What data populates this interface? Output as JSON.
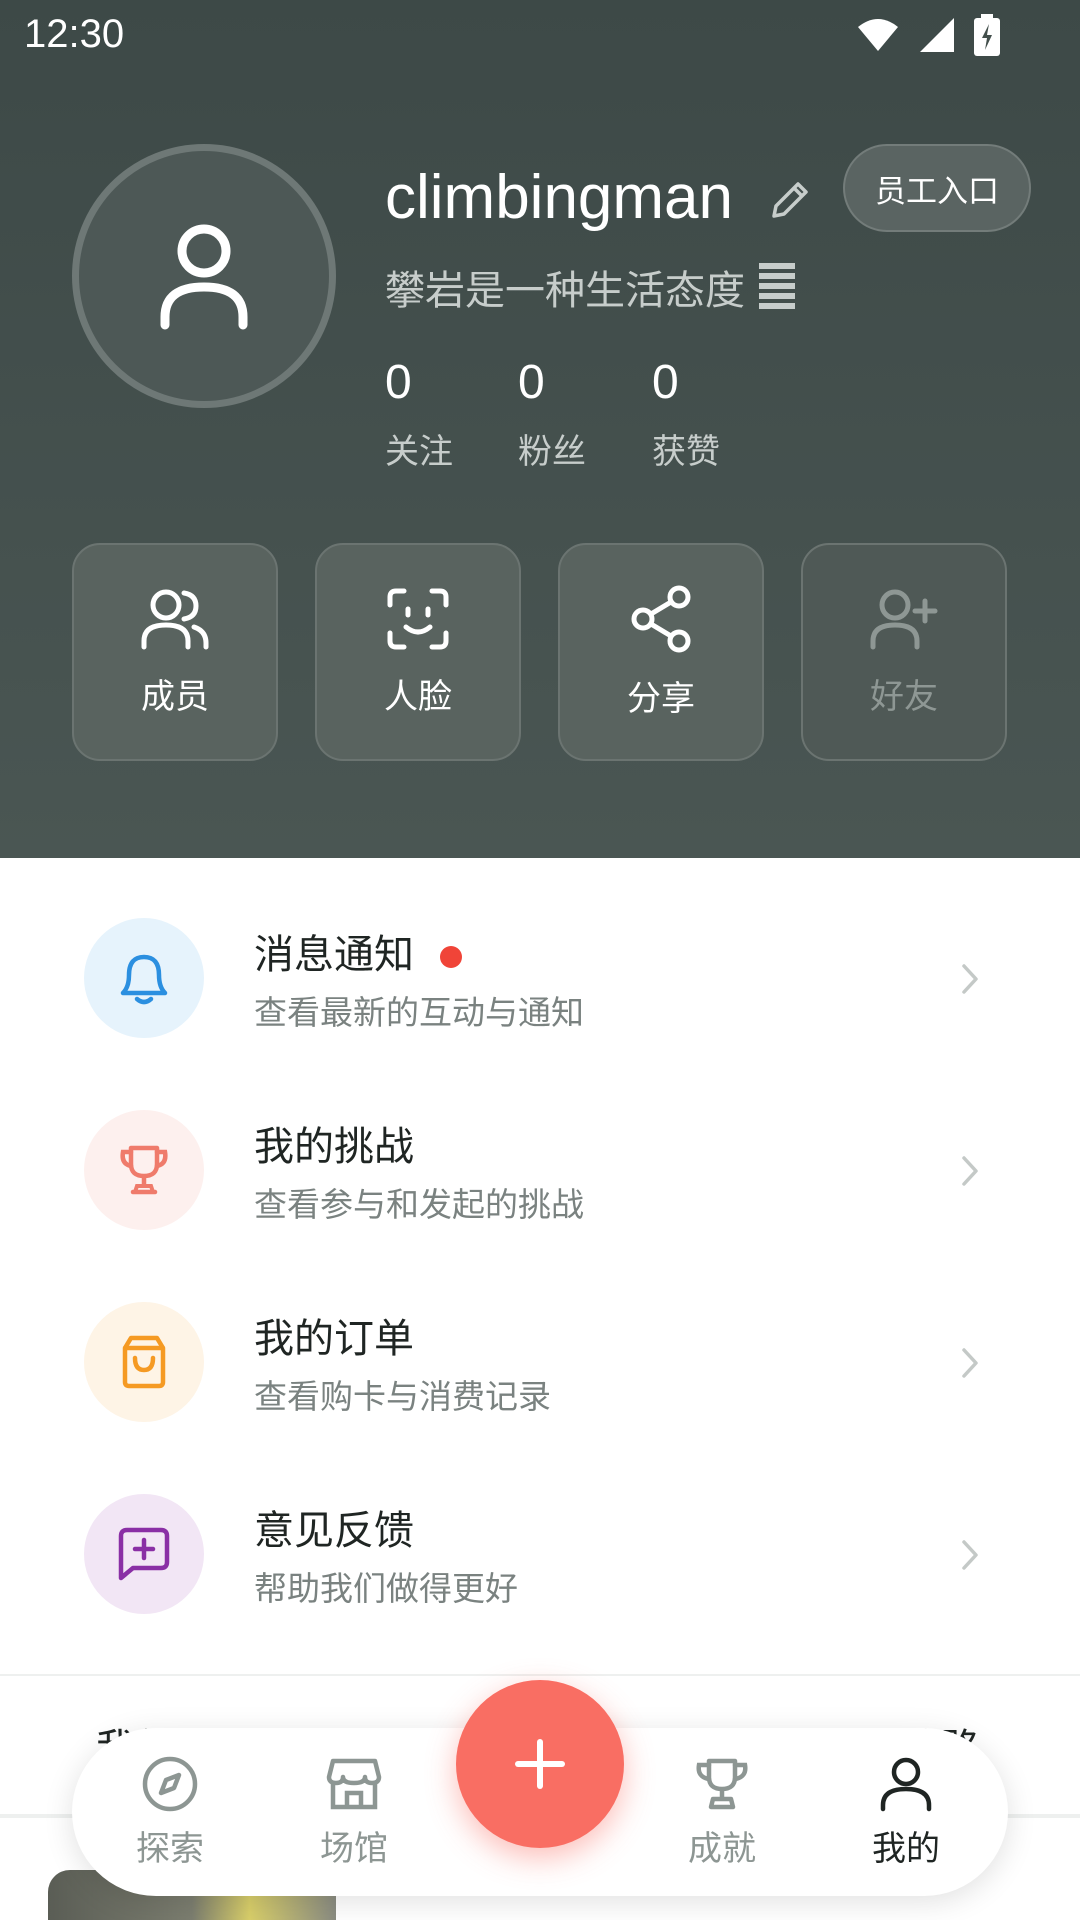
{
  "status_bar": {
    "time": "12:30",
    "icons": [
      "wifi-icon",
      "signal-icon",
      "battery-charging-icon"
    ]
  },
  "profile": {
    "username": "climbingman",
    "bio": "攀岩是一种生活态度",
    "staff_entry": "员工入口",
    "stats": [
      {
        "value": "0",
        "label": "关注"
      },
      {
        "value": "0",
        "label": "粉丝"
      },
      {
        "value": "0",
        "label": "获赞"
      }
    ]
  },
  "actions": [
    {
      "label": "成员",
      "icon": "users-icon"
    },
    {
      "label": "人脸",
      "icon": "face-scan-icon"
    },
    {
      "label": "分享",
      "icon": "share-icon"
    },
    {
      "label": "好友",
      "icon": "add-friend-icon"
    }
  ],
  "menu": [
    {
      "title": "消息通知",
      "subtitle": "查看最新的互动与通知",
      "icon": "bell-icon",
      "color": "#2b8fe0",
      "bg": "#e6f3fc",
      "badge": true
    },
    {
      "title": "我的挑战",
      "subtitle": "查看参与和发起的挑战",
      "icon": "trophy-icon",
      "color": "#ef7b6b",
      "bg": "#fdf0ee",
      "badge": false
    },
    {
      "title": "我的订单",
      "subtitle": "查看购卡与消费记录",
      "icon": "shopping-bag-icon",
      "color": "#f59a23",
      "bg": "#fef4e6",
      "badge": false
    },
    {
      "title": "意见反馈",
      "subtitle": "帮助我们做得更好",
      "icon": "feedback-icon",
      "color": "#8a2fa5",
      "bg": "#f2e6f5",
      "badge": false
    }
  ],
  "section_tabs": {
    "left": "我的动态",
    "right": "我的线路"
  },
  "bottom_nav": {
    "items": [
      {
        "label": "探索",
        "icon": "compass-icon"
      },
      {
        "label": "场馆",
        "icon": "store-icon"
      },
      {
        "label": "成就",
        "icon": "trophy-icon"
      },
      {
        "label": "我的",
        "icon": "user-icon"
      }
    ],
    "active": "我的",
    "fab_icon": "plus-icon"
  },
  "colors": {
    "header_bg": "#434f4c",
    "fab": "#f96e63",
    "badge": "#f04438"
  }
}
